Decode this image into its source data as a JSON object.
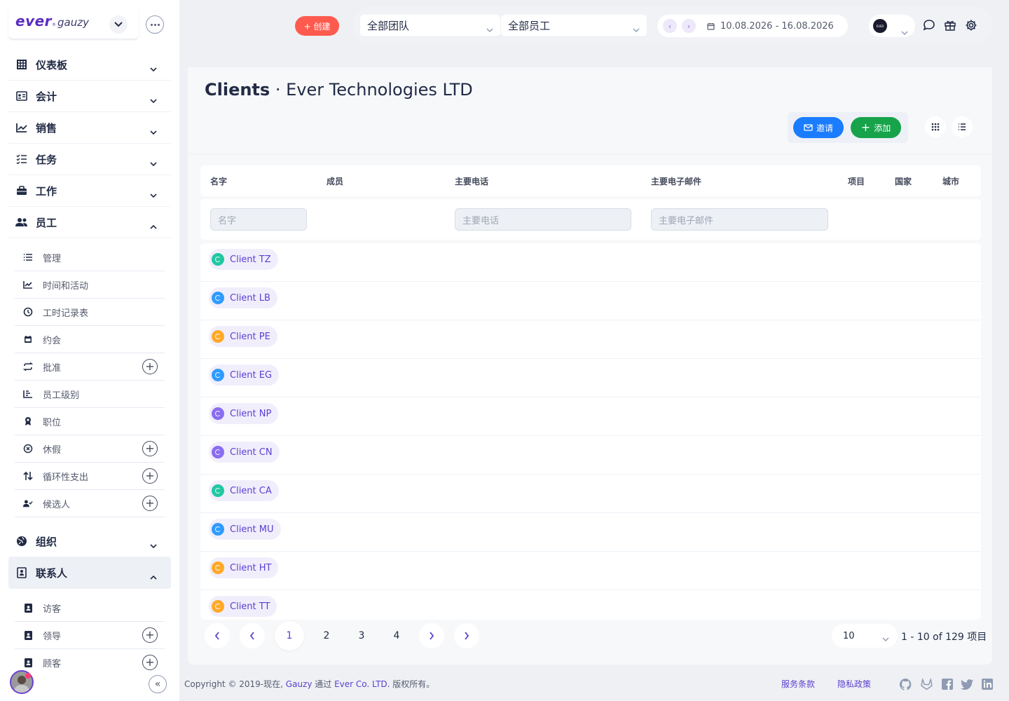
{
  "app": {
    "logo_main": "ever",
    "logo_sub": "gauzy"
  },
  "sidebar": {
    "menu": [
      {
        "label": "仪表板",
        "icon": "grid-table-icon",
        "expanded": false
      },
      {
        "label": "会计",
        "icon": "id-card-icon",
        "expanded": false
      },
      {
        "label": "销售",
        "icon": "line-chart-icon",
        "expanded": false
      },
      {
        "label": "任务",
        "icon": "task-list-icon",
        "expanded": false
      },
      {
        "label": "工作",
        "icon": "briefcase-icon",
        "expanded": false
      },
      {
        "label": "员工",
        "icon": "users-icon",
        "expanded": true
      }
    ],
    "employee_sub": [
      {
        "label": "管理",
        "icon": "list-icon",
        "plus": false
      },
      {
        "label": "时间和活动",
        "icon": "chart-line-icon",
        "plus": false
      },
      {
        "label": "工时记录表",
        "icon": "clock-icon",
        "plus": false
      },
      {
        "label": "约会",
        "icon": "calendar-icon",
        "plus": false
      },
      {
        "label": "批准",
        "icon": "repeat-icon",
        "plus": true
      },
      {
        "label": "员工级别",
        "icon": "bar-chart-icon",
        "plus": false
      },
      {
        "label": "职位",
        "icon": "award-icon",
        "plus": false
      },
      {
        "label": "休假",
        "icon": "close-circle-icon",
        "plus": true
      },
      {
        "label": "循环性支出",
        "icon": "sort-arrows-icon",
        "plus": true
      },
      {
        "label": "候选人",
        "icon": "user-check-icon",
        "plus": true
      }
    ],
    "org_menu": {
      "label": "组织",
      "icon": "globe-icon"
    },
    "contacts_menu": {
      "label": "联系人",
      "icon": "contact-book-icon"
    },
    "contacts_sub": [
      {
        "label": "访客",
        "icon": "address-book-icon",
        "plus": false
      },
      {
        "label": "领导",
        "icon": "address-book-icon",
        "plus": true
      },
      {
        "label": "顾客",
        "icon": "address-book-icon",
        "plus": true
      }
    ]
  },
  "header": {
    "create_label": "+ 创建",
    "team_select": "全部团队",
    "employee_select": "全部员工",
    "date_range": "10.08.2026 - 16.08.2026",
    "org_logo_text": "EVER"
  },
  "page": {
    "title_bold": "Clients",
    "title_rest": " · Ever Technologies LTD",
    "invite_label": "邀请",
    "add_label": "添加"
  },
  "table": {
    "columns": [
      "名字",
      "成员",
      "主要电话",
      "主要电子邮件",
      "项目",
      "国家",
      "城市"
    ],
    "filters": {
      "name_placeholder": "名字",
      "phone_placeholder": "主要电话",
      "email_placeholder": "主要电子邮件"
    },
    "rows": [
      {
        "name": "Client TZ",
        "color": "#22c7a0"
      },
      {
        "name": "Client LB",
        "color": "#2f9bff"
      },
      {
        "name": "Client PE",
        "color": "#ffa928"
      },
      {
        "name": "Client EG",
        "color": "#2f9bff"
      },
      {
        "name": "Client NP",
        "color": "#8a6cf0"
      },
      {
        "name": "Client CN",
        "color": "#8a6cf0"
      },
      {
        "name": "Client CA",
        "color": "#22c7a0"
      },
      {
        "name": "Client MU",
        "color": "#2f9bff"
      },
      {
        "name": "Client HT",
        "color": "#ffa928"
      },
      {
        "name": "Client TT",
        "color": "#ffa928"
      }
    ]
  },
  "pagination": {
    "pages": [
      "1",
      "2",
      "3",
      "4"
    ],
    "current": "1",
    "page_size": "10",
    "info": "1 - 10 of 129 项目"
  },
  "footer": {
    "copyright_prefix": "Copyright © 2019-现在, ",
    "gauzy": "Gauzy",
    "middle": " 通过 ",
    "company": "Ever Co. LTD.",
    "suffix": " 版权所有。",
    "terms": "服务条款",
    "privacy": "隐私政策"
  },
  "colors": {
    "accent": "#5b3fd0",
    "create": "#ff5a4e",
    "invite": "#1a7cff",
    "add": "#16a34a"
  }
}
